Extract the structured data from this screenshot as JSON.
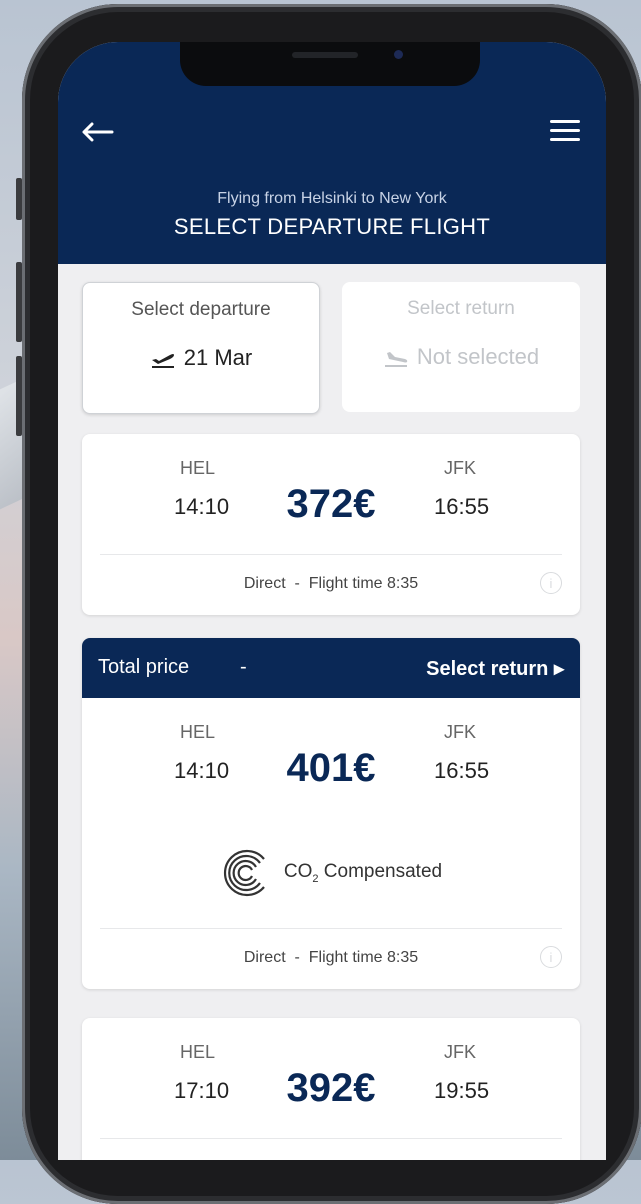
{
  "header": {
    "subtitle": "Flying from Helsinki to New York",
    "title": "SELECT DEPARTURE FLIGHT"
  },
  "date_tabs": {
    "departure": {
      "label": "Select departure",
      "value": "21 Mar"
    },
    "return": {
      "label": "Select return",
      "value": "Not selected"
    }
  },
  "flights": [
    {
      "from": "HEL",
      "to": "JFK",
      "dep_time": "14:10",
      "arr_time": "16:55",
      "price": "372€",
      "info": "Direct  -  Flight time 8:35"
    },
    {
      "from": "HEL",
      "to": "JFK",
      "dep_time": "14:10",
      "arr_time": "16:55",
      "price": "401€",
      "info": "Direct  -  Flight time 8:35",
      "co2_prefix": "CO",
      "co2_sub": "2",
      "co2_suffix": " Compensated"
    },
    {
      "from": "HEL",
      "to": "JFK",
      "dep_time": "17:10",
      "arr_time": "19:55",
      "price": "392€"
    }
  ],
  "selected_bar": {
    "total_price_label": "Total price",
    "total_price_value": "-",
    "select_return_label": "Select return ▸"
  },
  "colors": {
    "primary": "#0a2856",
    "background": "#efeff1"
  }
}
